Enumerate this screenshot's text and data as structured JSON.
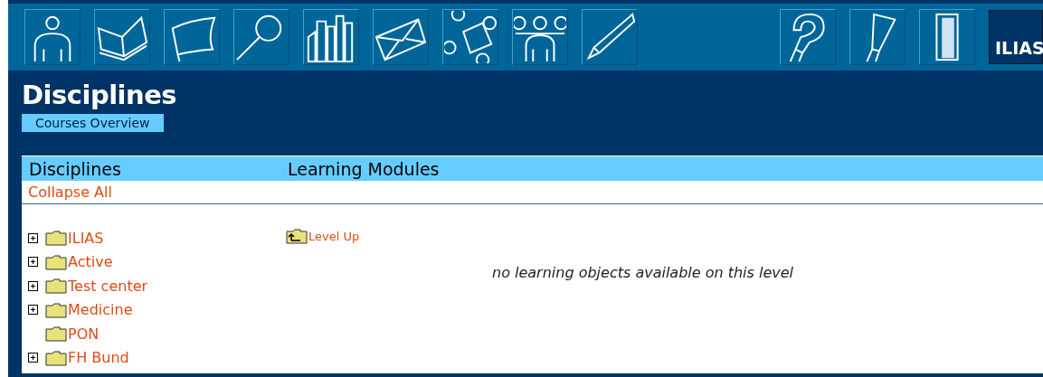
{
  "toolbar": {
    "logo": "ILIAS"
  },
  "header": {
    "title": "Disciplines",
    "tabs": [
      {
        "label": "Courses Overview",
        "selected": true
      }
    ]
  },
  "columns": [
    "Disciplines",
    "Learning Modules"
  ],
  "collapse_link": "Collapse All",
  "tree": [
    {
      "label": "ILIAS",
      "expandable": true
    },
    {
      "label": "Active",
      "expandable": true
    },
    {
      "label": "Test center",
      "expandable": true
    },
    {
      "label": "Medicine",
      "expandable": true
    },
    {
      "label": "PON",
      "expandable": false
    },
    {
      "label": "FH Bund",
      "expandable": true
    }
  ],
  "modules": {
    "level_up": "Level Up",
    "message": "no learning objects available on this level"
  }
}
